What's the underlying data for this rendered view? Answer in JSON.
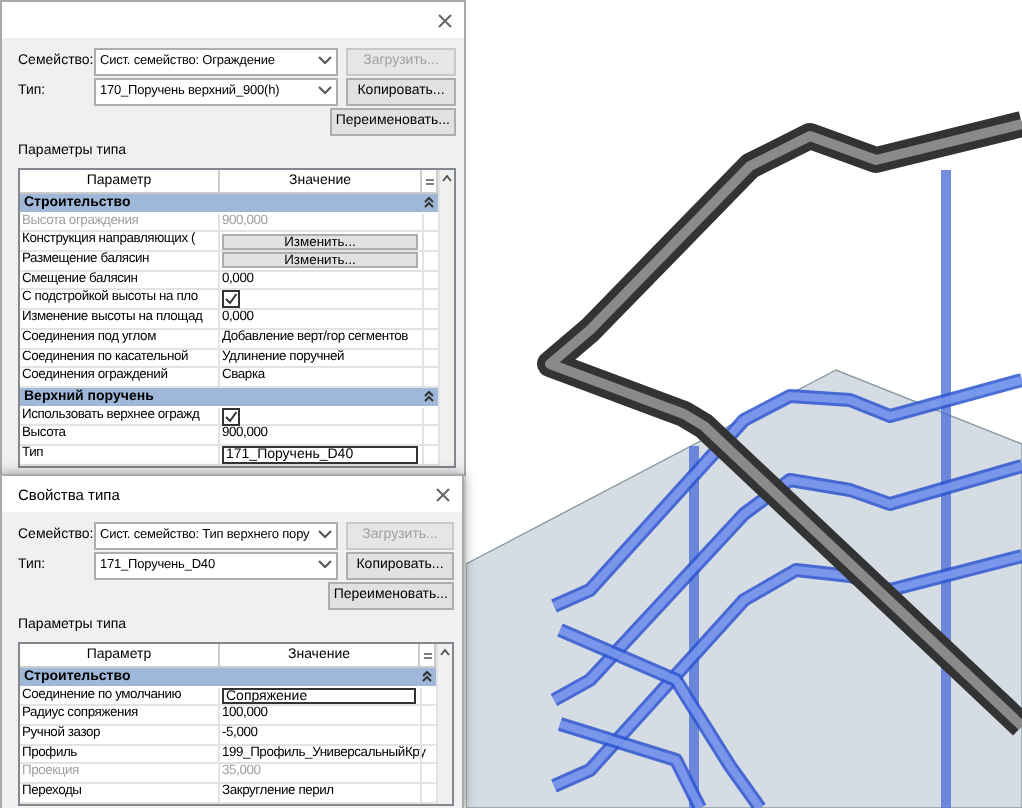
{
  "back_dialog": {
    "family_label": "Семейство:",
    "family_value": "Сист. семейство: Ограждение",
    "load_button": {
      "label": "Загрузить...",
      "disabled": true
    },
    "type_label": "Тип:",
    "type_value": "170_Поручень верхний_900(h)",
    "copy_button": "Копировать...",
    "rename_button": "Переименовать...",
    "params_label": "Параметры типа",
    "columns": [
      "Параметр",
      "Значение"
    ],
    "sections": [
      {
        "title": "Строительство",
        "expanded": true,
        "rows": [
          {
            "kind": "text",
            "name": "Высота ограждения",
            "value": "900,000",
            "disabled": true
          },
          {
            "kind": "button",
            "name": "Конструкция направляющих (",
            "value": "Изменить...",
            "disabled": false
          },
          {
            "kind": "button",
            "name": "Размещение балясин",
            "value": "Изменить...",
            "disabled": false
          },
          {
            "kind": "text",
            "name": "Смещение балясин",
            "value": "0,000",
            "disabled": false
          },
          {
            "kind": "checkbox",
            "name": "С подстройкой высоты на пло",
            "checked": true,
            "disabled": false
          },
          {
            "kind": "text",
            "name": "Изменение высоты на площад",
            "value": "0,000",
            "disabled": false
          },
          {
            "kind": "text",
            "name": "Соединения под углом",
            "value": "Добавление верт/гор сегментов",
            "disabled": false
          },
          {
            "kind": "text",
            "name": "Соединения по касательной",
            "value": "Удлинение поручней",
            "disabled": false
          },
          {
            "kind": "text",
            "name": "Соединения ограждений",
            "value": "Сварка",
            "disabled": false
          }
        ]
      },
      {
        "title": "Верхний поручень",
        "expanded": true,
        "rows": [
          {
            "kind": "checkbox",
            "name": "Использовать верхнее огражд",
            "checked": true,
            "disabled": false
          },
          {
            "kind": "text",
            "name": "Высота",
            "value": "900,000",
            "disabled": false
          },
          {
            "kind": "field",
            "name": "Тип",
            "value": "171_Поручень_D40",
            "disabled": false
          }
        ]
      }
    ]
  },
  "front_dialog": {
    "title": "Свойства типа",
    "family_label": "Семейство:",
    "family_value": "Сист. семейство: Тип верхнего пору",
    "load_button": {
      "label": "Загрузить...",
      "disabled": true
    },
    "type_label": "Тип:",
    "type_value": "171_Поручень_D40",
    "copy_button": "Копировать...",
    "rename_button": "Переименовать...",
    "params_label": "Параметры типа",
    "columns": [
      "Параметр",
      "Значение"
    ],
    "sections": [
      {
        "title": "Строительство",
        "expanded": true,
        "rows": [
          {
            "kind": "field",
            "name": "Соединение по умолчанию",
            "value": "Сопряжение",
            "disabled": false
          },
          {
            "kind": "text",
            "name": "Радиус сопряжения",
            "value": "100,000",
            "disabled": false
          },
          {
            "kind": "text",
            "name": "Ручной зазор",
            "value": "-5,000",
            "disabled": false
          },
          {
            "kind": "text",
            "name": "Профиль",
            "value": "199_Профиль_УниверсальныйКру",
            "disabled": false
          },
          {
            "kind": "text",
            "name": "Проекция",
            "value": "35,000",
            "disabled": true
          },
          {
            "kind": "text",
            "name": "Переходы",
            "value": "Закругление перил",
            "disabled": false
          }
        ]
      }
    ]
  }
}
